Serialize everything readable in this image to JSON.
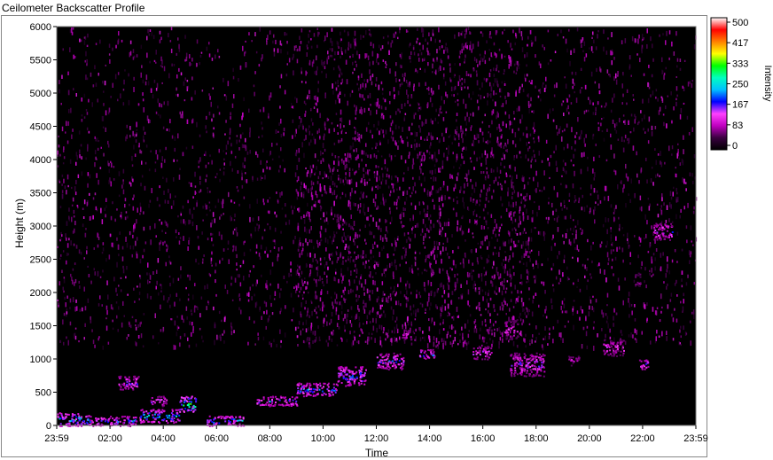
{
  "window": {
    "title": "Ceilometer Backscatter Profile"
  },
  "chart_data": {
    "type": "heatmap",
    "title": "Ceilometer Backscatter Profile",
    "xlabel": "Time",
    "ylabel": "Height (m)",
    "x_tick_labels": [
      "23:59",
      "02:00",
      "04:00",
      "06:00",
      "08:00",
      "10:00",
      "12:00",
      "14:00",
      "16:00",
      "18:00",
      "20:00",
      "22:00",
      "23:59"
    ],
    "y_tick_labels": [
      "0",
      "500",
      "1000",
      "1500",
      "2000",
      "2500",
      "3000",
      "3500",
      "4000",
      "4500",
      "5000",
      "5500",
      "6000"
    ],
    "y_range": [
      0,
      6000
    ],
    "x_range_hours": [
      0,
      24
    ],
    "colorbar": {
      "label": "Intensity",
      "range": [
        0,
        500
      ],
      "tick_labels": [
        "500",
        "417",
        "333",
        "250",
        "167",
        "83",
        "0"
      ],
      "colormap": [
        "#000000",
        "#3a0040",
        "#c000c0",
        "#ff40ff",
        "#0000ff",
        "#00c0ff",
        "#00ffc0",
        "#00ff00",
        "#ffff00",
        "#ff8000",
        "#ff0000",
        "#ffffff"
      ]
    },
    "background_noise": {
      "height_range": [
        1200,
        6000
      ],
      "intensity_range": [
        30,
        110
      ],
      "peak_time_hours": [
        9,
        18
      ]
    },
    "features": [
      {
        "t_start": 0.0,
        "t_end": 1.2,
        "h_bottom": 0,
        "h_top": 200,
        "intensity": 280
      },
      {
        "t_start": 1.2,
        "t_end": 3.0,
        "h_bottom": 0,
        "h_top": 150,
        "intensity": 220
      },
      {
        "t_start": 2.3,
        "t_end": 3.1,
        "h_bottom": 550,
        "h_top": 750,
        "intensity": 200
      },
      {
        "t_start": 3.1,
        "t_end": 4.6,
        "h_bottom": 50,
        "h_top": 250,
        "intensity": 260
      },
      {
        "t_start": 3.5,
        "t_end": 4.1,
        "h_bottom": 300,
        "h_top": 450,
        "intensity": 180
      },
      {
        "t_start": 4.6,
        "t_end": 5.2,
        "h_bottom": 200,
        "h_top": 450,
        "intensity": 320
      },
      {
        "t_start": 5.6,
        "t_end": 7.0,
        "h_bottom": 0,
        "h_top": 150,
        "intensity": 260
      },
      {
        "t_start": 7.5,
        "t_end": 9.0,
        "h_bottom": 300,
        "h_top": 450,
        "intensity": 220
      },
      {
        "t_start": 9.0,
        "t_end": 10.5,
        "h_bottom": 450,
        "h_top": 650,
        "intensity": 240
      },
      {
        "t_start": 10.5,
        "t_end": 11.6,
        "h_bottom": 600,
        "h_top": 900,
        "intensity": 230
      },
      {
        "t_start": 12.0,
        "t_end": 13.0,
        "h_bottom": 850,
        "h_top": 1100,
        "intensity": 200
      },
      {
        "t_start": 13.6,
        "t_end": 14.2,
        "h_bottom": 1000,
        "h_top": 1150,
        "intensity": 220
      },
      {
        "t_start": 12.9,
        "t_end": 13.3,
        "h_bottom": 1300,
        "h_top": 1450,
        "intensity": 160
      },
      {
        "t_start": 15.6,
        "t_end": 16.3,
        "h_bottom": 1000,
        "h_top": 1200,
        "intensity": 170
      },
      {
        "t_start": 17.0,
        "t_end": 18.3,
        "h_bottom": 750,
        "h_top": 1100,
        "intensity": 180
      },
      {
        "t_start": 16.8,
        "t_end": 17.3,
        "h_bottom": 1300,
        "h_top": 1600,
        "intensity": 140
      },
      {
        "t_start": 19.2,
        "t_end": 19.6,
        "h_bottom": 900,
        "h_top": 1050,
        "intensity": 140
      },
      {
        "t_start": 20.5,
        "t_end": 21.3,
        "h_bottom": 1050,
        "h_top": 1300,
        "intensity": 150
      },
      {
        "t_start": 21.8,
        "t_end": 22.2,
        "h_bottom": 850,
        "h_top": 1000,
        "intensity": 200
      },
      {
        "t_start": 21.7,
        "t_end": 21.9,
        "h_bottom": 2100,
        "h_top": 2300,
        "intensity": 130
      },
      {
        "t_start": 22.4,
        "t_end": 23.1,
        "h_bottom": 2800,
        "h_top": 3050,
        "intensity": 180
      }
    ]
  }
}
